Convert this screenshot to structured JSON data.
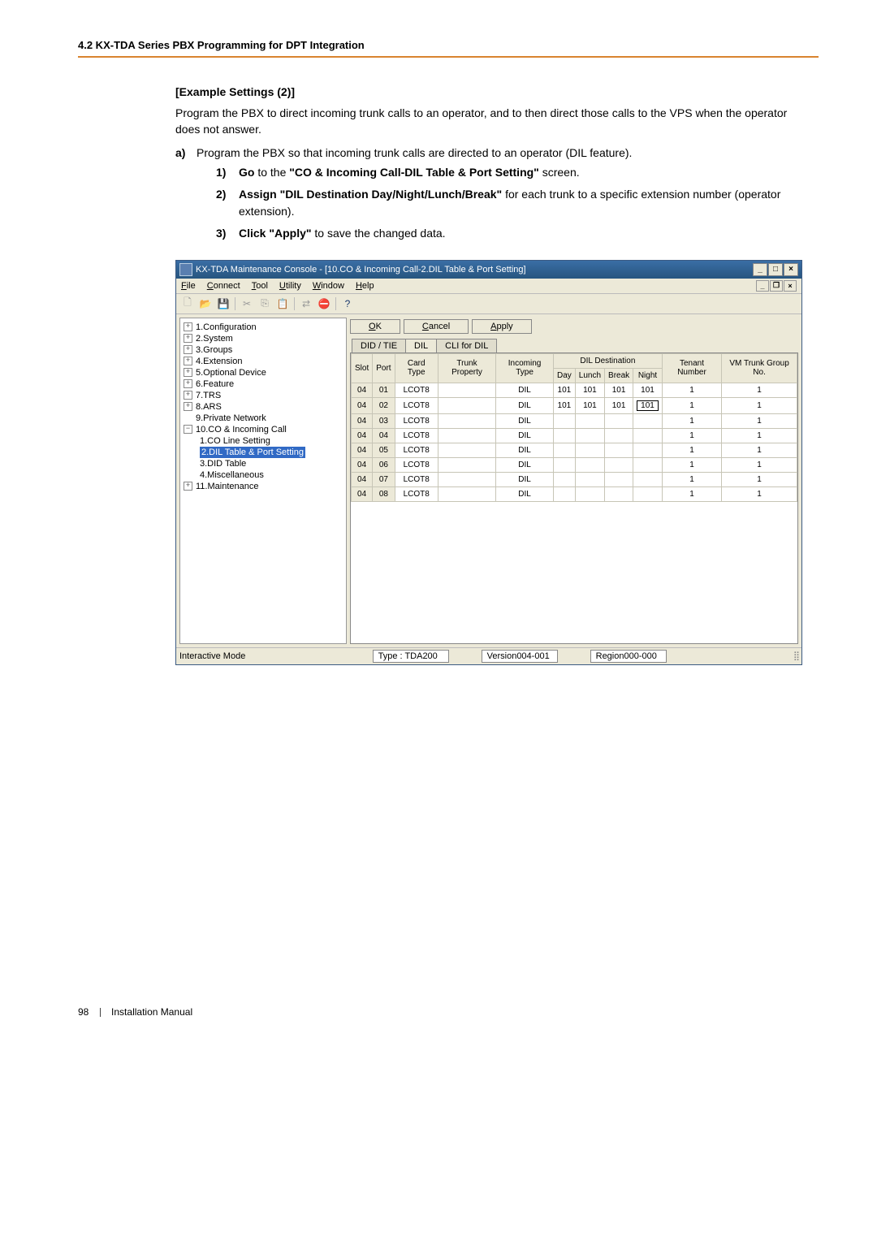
{
  "header": {
    "section": "4.2 KX-TDA Series PBX Programming for DPT Integration"
  },
  "content": {
    "example_title": "[Example Settings (2)]",
    "intro": "Program the PBX to direct incoming trunk calls to an operator, and to then direct those calls to the VPS when the operator does not answer.",
    "step_a_marker": "a)",
    "step_a_text": "Program the PBX so that incoming trunk calls are directed to an operator (DIL feature).",
    "sub1_num": "1)",
    "sub1_pre": "Go",
    "sub1_mid": " to the ",
    "sub1_bold": "\"CO & Incoming Call-DIL Table & Port Setting\"",
    "sub1_post": " screen.",
    "sub2_num": "2)",
    "sub2_bold": "Assign \"DIL Destination Day/Night/Lunch/Break\"",
    "sub2_post": " for each trunk to a specific extension number (operator extension).",
    "sub3_num": "3)",
    "sub3_bold": "Click \"Apply\"",
    "sub3_post": " to save the changed data."
  },
  "win": {
    "title": "KX-TDA Maintenance Console - [10.CO & Incoming Call-2.DIL Table & Port Setting]",
    "wc_min": "_",
    "wc_max": "□",
    "wc_close": "×",
    "menus": {
      "file": "File",
      "connect": "Connect",
      "tool": "Tool",
      "utility": "Utility",
      "window": "Window",
      "help": "Help"
    },
    "child_wc": {
      "min": "_",
      "max": "❐",
      "close": "×"
    },
    "toolbar_help": "?",
    "btns": {
      "ok": "OK",
      "cancel": "Cancel",
      "apply": "Apply"
    },
    "tabs": {
      "didtie": "DID / TIE",
      "dil": "DIL",
      "cli": "CLI for DIL"
    },
    "tree": {
      "n1": "1.Configuration",
      "n2": "2.System",
      "n3": "3.Groups",
      "n4": "4.Extension",
      "n5": "5.Optional Device",
      "n6": "6.Feature",
      "n7": "7.TRS",
      "n8": "8.ARS",
      "n9": "9.Private Network",
      "n10": "10.CO & Incoming Call",
      "n10_1": "1.CO Line Setting",
      "n10_2": "2.DIL Table & Port Setting",
      "n10_3": "3.DID Table",
      "n10_4": "4.Miscellaneous",
      "n11": "11.Maintenance"
    },
    "cols": {
      "slot": "Slot",
      "port": "Port",
      "card": "Card Type",
      "trunk": "Trunk Property",
      "incoming": "Incoming Type",
      "dildest": "DIL Destination",
      "day": "Day",
      "lunch": "Lunch",
      "break": "Break",
      "night": "Night",
      "tenant": "Tenant Number",
      "vm": "VM Trunk Group No."
    },
    "rows": [
      {
        "slot": "04",
        "port": "01",
        "card": "LCOT8",
        "trunk": "",
        "incoming": "DIL",
        "day": "101",
        "lunch": "101",
        "break": "101",
        "night": "101",
        "tenant": "1",
        "vm": "1"
      },
      {
        "slot": "04",
        "port": "02",
        "card": "LCOT8",
        "trunk": "",
        "incoming": "DIL",
        "day": "101",
        "lunch": "101",
        "break": "101",
        "night": "101",
        "tenant": "1",
        "vm": "1",
        "night_edit": true
      },
      {
        "slot": "04",
        "port": "03",
        "card": "LCOT8",
        "trunk": "",
        "incoming": "DIL",
        "day": "",
        "lunch": "",
        "break": "",
        "night": "",
        "tenant": "1",
        "vm": "1"
      },
      {
        "slot": "04",
        "port": "04",
        "card": "LCOT8",
        "trunk": "",
        "incoming": "DIL",
        "day": "",
        "lunch": "",
        "break": "",
        "night": "",
        "tenant": "1",
        "vm": "1"
      },
      {
        "slot": "04",
        "port": "05",
        "card": "LCOT8",
        "trunk": "",
        "incoming": "DIL",
        "day": "",
        "lunch": "",
        "break": "",
        "night": "",
        "tenant": "1",
        "vm": "1"
      },
      {
        "slot": "04",
        "port": "06",
        "card": "LCOT8",
        "trunk": "",
        "incoming": "DIL",
        "day": "",
        "lunch": "",
        "break": "",
        "night": "",
        "tenant": "1",
        "vm": "1"
      },
      {
        "slot": "04",
        "port": "07",
        "card": "LCOT8",
        "trunk": "",
        "incoming": "DIL",
        "day": "",
        "lunch": "",
        "break": "",
        "night": "",
        "tenant": "1",
        "vm": "1"
      },
      {
        "slot": "04",
        "port": "08",
        "card": "LCOT8",
        "trunk": "",
        "incoming": "DIL",
        "day": "",
        "lunch": "",
        "break": "",
        "night": "",
        "tenant": "1",
        "vm": "1"
      }
    ],
    "status": {
      "mode": "Interactive Mode",
      "type": "Type : TDA200",
      "version": "Version004-001",
      "region": "Region000-000"
    }
  },
  "footer": {
    "page": "98",
    "doc": "Installation Manual"
  }
}
